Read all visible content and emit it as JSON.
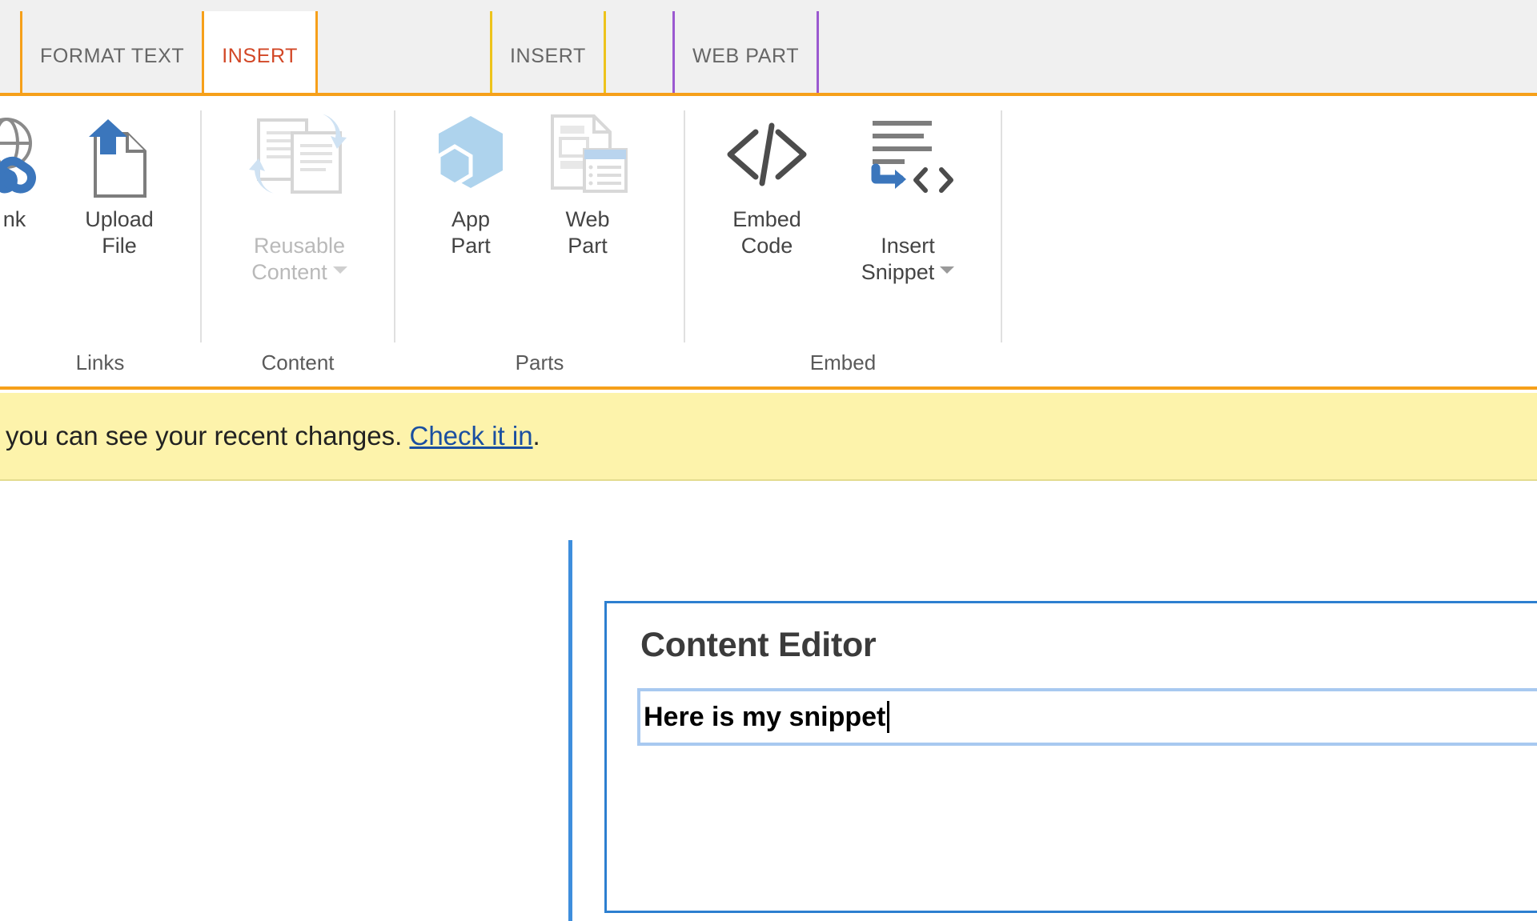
{
  "tab_groups": [
    {
      "name": "page-tools",
      "color": "#f6a01a",
      "tabs": [
        {
          "label": "FORMAT TEXT",
          "active": false
        },
        {
          "label": "INSERT",
          "active": true
        }
      ]
    },
    {
      "name": "insert-contextual",
      "color": "#edc31b",
      "tabs": [
        {
          "label": "INSERT",
          "active": false
        }
      ]
    },
    {
      "name": "web-part-tools",
      "color": "#9b59d0",
      "tabs": [
        {
          "label": "WEB PART",
          "active": false
        }
      ]
    }
  ],
  "ribbon": {
    "groups": [
      {
        "label": "Links",
        "buttons": [
          {
            "label": "nk",
            "icon": "hyperlink-icon",
            "disabled": false,
            "caret": false
          },
          {
            "label": "Upload\nFile",
            "icon": "upload-file-icon",
            "disabled": false,
            "caret": false
          }
        ]
      },
      {
        "label": "Content",
        "buttons": [
          {
            "label": "Reusable\nContent",
            "icon": "reusable-content-icon",
            "disabled": true,
            "caret": true
          }
        ]
      },
      {
        "label": "Parts",
        "buttons": [
          {
            "label": "App\nPart",
            "icon": "app-part-icon",
            "disabled": false,
            "caret": false
          },
          {
            "label": "Web\nPart",
            "icon": "web-part-icon",
            "disabled": false,
            "caret": false
          }
        ]
      },
      {
        "label": "Embed",
        "buttons": [
          {
            "label": "Embed\nCode",
            "icon": "embed-code-icon",
            "disabled": false,
            "caret": false
          },
          {
            "label": "Insert\nSnippet",
            "icon": "insert-snippet-icon",
            "disabled": false,
            "caret": true
          }
        ]
      }
    ]
  },
  "notification": {
    "message": "ly you can see your recent changes. ",
    "link_text": "Check it in",
    "suffix": "."
  },
  "web_part": {
    "title": "Content Editor",
    "editable_value": "Here is my snippet"
  },
  "colors": {
    "accent_orange": "#f6a01a",
    "accent_gold": "#edc31b",
    "accent_purple": "#9b59d0",
    "active_tab_text": "#d24726",
    "notify_bg": "#fdf3ab",
    "webpart_border": "#2d7fd0",
    "field_border": "#a8c9f0"
  }
}
